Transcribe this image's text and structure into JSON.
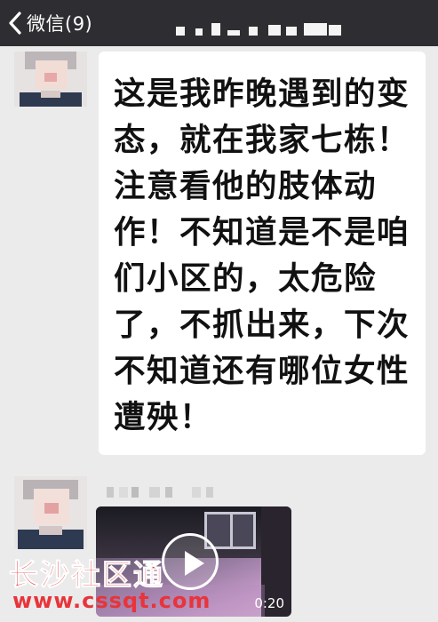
{
  "header": {
    "back_label": "微信(9)",
    "title": ""
  },
  "messages": [
    {
      "type": "text",
      "text": "这是我昨晚遇到的变态，就在我家七栋！注意看他的肢体动作！不知道是不是咱们小区的，太危险了，不抓出来，下次不知道还有哪位女性遭殃！"
    },
    {
      "type": "video",
      "duration": "0:20"
    }
  ],
  "watermark": {
    "name": "长沙社区通",
    "url": "www.cssqt.com"
  },
  "colors": {
    "header_bg": "#2e2e32",
    "chat_bg": "#ebebeb",
    "bubble_bg": "#ffffff",
    "watermark": "#e8343a"
  }
}
